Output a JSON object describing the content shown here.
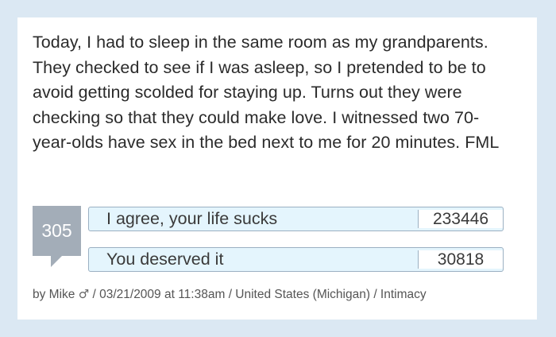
{
  "post": {
    "text": "Today, I had to sleep in the same room as my grandparents. They checked to see if I was asleep, so I pretended to be to avoid getting scolded for staying up. Turns out they were checking so that they could make love. I witnessed two 70-year-olds have sex in the bed next to me for 20 minutes. FML"
  },
  "comments": {
    "count": "305"
  },
  "votes": [
    {
      "label": "I agree, your life sucks",
      "count": "233446"
    },
    {
      "label": "You deserved it",
      "count": "30818"
    }
  ],
  "meta": {
    "prefix": "by Mike",
    "gender_icon": "male-symbol-icon",
    "gender_glyph": "♂",
    "details": "/ 03/21/2009 at 11:38am / United States (Michigan) / Intimacy"
  },
  "colors": {
    "page_background": "#dbe8f3",
    "card_background": "#ffffff",
    "comment_badge": "#a3adb8",
    "vote_background": "#e4f5fd",
    "vote_border": "#9bb0c2"
  }
}
